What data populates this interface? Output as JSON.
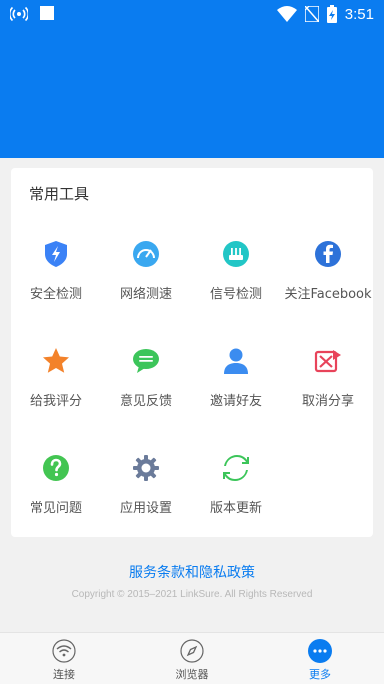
{
  "status_bar": {
    "time": "3:51"
  },
  "tools": {
    "title": "常用工具",
    "items": [
      {
        "label": "安全检测",
        "icon": "shield-lightning-icon"
      },
      {
        "label": "网络测速",
        "icon": "speedometer-icon"
      },
      {
        "label": "信号检测",
        "icon": "router-icon"
      },
      {
        "label": "关注Facebook",
        "icon": "facebook-icon"
      },
      {
        "label": "给我评分",
        "icon": "star-icon"
      },
      {
        "label": "意见反馈",
        "icon": "chat-bubble-icon"
      },
      {
        "label": "邀请好友",
        "icon": "person-icon"
      },
      {
        "label": "取消分享",
        "icon": "cancel-share-icon"
      },
      {
        "label": "常见问题",
        "icon": "question-icon"
      },
      {
        "label": "应用设置",
        "icon": "gear-icon"
      },
      {
        "label": "版本更新",
        "icon": "refresh-icon"
      }
    ]
  },
  "footer": {
    "policy_link": "服务条款和隐私政策",
    "copyright": "Copyright © 2015–2021 LinkSure. All Rights Reserved"
  },
  "nav": {
    "items": [
      {
        "label": "连接",
        "icon": "wifi-icon"
      },
      {
        "label": "浏览器",
        "icon": "compass-icon"
      },
      {
        "label": "更多",
        "icon": "more-icon"
      }
    ],
    "active": "更多"
  },
  "colors": {
    "primary": "#0a7cf0",
    "background": "#f1f1f1"
  }
}
